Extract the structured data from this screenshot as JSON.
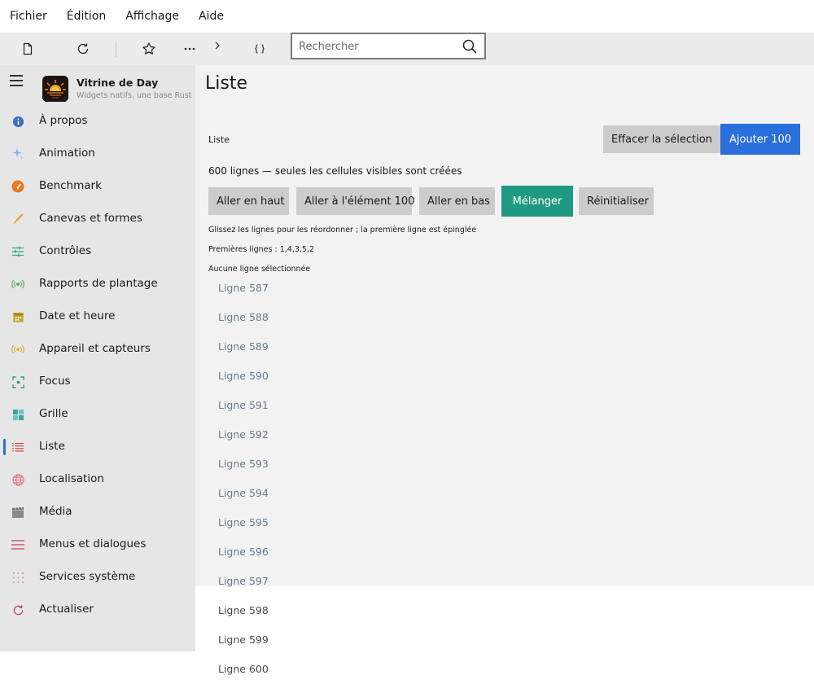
{
  "menubar": {
    "items": [
      "Fichier",
      "Édition",
      "Affichage",
      "Aide"
    ]
  },
  "toolbar": {
    "icons": [
      "new-file-icon",
      "refresh-icon",
      "star-icon",
      "more-icon",
      "chevron-right-icon",
      "braces-icon"
    ],
    "search_placeholder": "Rechercher"
  },
  "sidebar": {
    "app_title": "Vitrine de Day",
    "app_subtitle": "Widgets natifs, une base Rust",
    "items": [
      {
        "label": "À propos",
        "icon": "info-icon",
        "color": "#3b6fc4"
      },
      {
        "label": "Animation",
        "icon": "sparkle-icon",
        "color": "#5aa0e0"
      },
      {
        "label": "Benchmark",
        "icon": "gauge-icon",
        "color": "#e87a1f"
      },
      {
        "label": "Canevas et formes",
        "icon": "brush-icon",
        "color": "#e0a030"
      },
      {
        "label": "Contrôles",
        "icon": "sliders-icon",
        "color": "#3aa87a"
      },
      {
        "label": "Rapports de plantage",
        "icon": "broadcast-icon",
        "color": "#4caf50"
      },
      {
        "label": "Date et heure",
        "icon": "calendar-icon",
        "color": "#c9a227"
      },
      {
        "label": "Appareil et capteurs",
        "icon": "sensor-icon",
        "color": "#e0b030"
      },
      {
        "label": "Focus",
        "icon": "focus-icon",
        "color": "#2a9a8a"
      },
      {
        "label": "Grille",
        "icon": "grid-icon",
        "color": "#3aa8a0"
      },
      {
        "label": "Liste",
        "icon": "list-icon",
        "color": "#d04040"
      },
      {
        "label": "Localisation",
        "icon": "globe-icon",
        "color": "#e07070"
      },
      {
        "label": "Média",
        "icon": "clapper-icon",
        "color": "#8a8a8a"
      },
      {
        "label": "Menus et dialogues",
        "icon": "menu-icon",
        "color": "#d05060"
      },
      {
        "label": "Services système",
        "icon": "dots-grid-icon",
        "color": "#d08090"
      },
      {
        "label": "Actualiser",
        "icon": "refresh-icon",
        "color": "#c04070"
      }
    ],
    "active_index": 10
  },
  "main": {
    "title": "Liste",
    "list_label": "Liste",
    "clear_selection": "Effacer la sélection",
    "add_100": "Ajouter 100",
    "count_text": "600 lignes — seules les cellules visibles sont créées",
    "buttons": [
      "Aller en haut",
      "Aller à l'élément 100",
      "Aller en bas",
      "Mélanger",
      "Réinitialiser"
    ],
    "drag_hint": "Glissez les lignes pour les réordonner ; la première ligne est épinglée",
    "first_rows": "Premières lignes : 1,4,3,5,2",
    "selection_text": "Aucune ligne sélectionnée",
    "rows": [
      "Ligne 587",
      "Ligne 588",
      "Ligne 589",
      "Ligne 590",
      "Ligne 591",
      "Ligne 592",
      "Ligne 593",
      "Ligne 594",
      "Ligne 595",
      "Ligne 596",
      "Ligne 597",
      "Ligne 598",
      "Ligne 599",
      "Ligne 600"
    ]
  },
  "colors": {
    "primary": "#2a6fdb",
    "teal": "#1f9a82",
    "button_gray": "#cccccc",
    "sidebar_bg": "#e6e6e6",
    "main_bg": "#f2f2f2"
  }
}
